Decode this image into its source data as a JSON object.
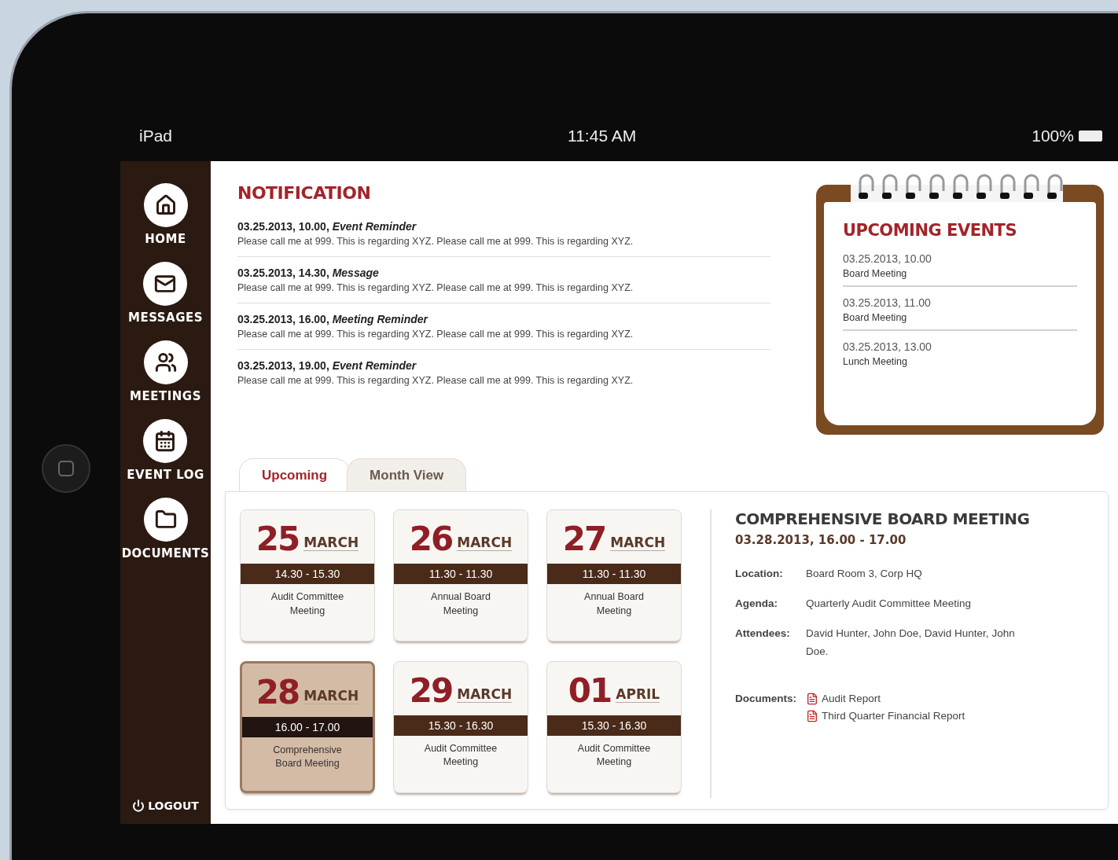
{
  "status_bar": {
    "device": "iPad",
    "time": "11:45 AM",
    "battery": "100%"
  },
  "sidebar": {
    "items": [
      {
        "label": "HOME",
        "selected": false
      },
      {
        "label": "MESSAGES",
        "selected": false
      },
      {
        "label": "MEETINGS",
        "selected": false
      },
      {
        "label": "EVENT LOG",
        "selected": false
      },
      {
        "label": "DOCUMENTS",
        "selected": false
      }
    ],
    "logout": "LOGOUT"
  },
  "notifications": {
    "title": "NOTIFICATION",
    "items": [
      {
        "heading": "03.25.2013, 10.00, *Event Reminder*",
        "message": "Please call me at 999. This is regarding XYZ. Please call me at 999. This is regarding XYZ."
      },
      {
        "heading": "03.25.2013, 14.30, *Message*",
        "message": "Please call me at 999. This is regarding XYZ. Please call me at 999. This is regarding XYZ."
      },
      {
        "heading": "03.25.2013, 16.00, *Meeting Reminder*",
        "message": "Please call me at 999. This is regarding XYZ. Please call me at 999. This is regarding XYZ."
      },
      {
        "heading": "03.25.2013, 19.00, *Event Reminder*",
        "message": "Please call me at 999. This is regarding XYZ. Please call me at 999. This is regarding XYZ."
      }
    ]
  },
  "upcoming_events": {
    "title": "UPCOMING EVENTS",
    "items": [
      {
        "datetime": "03.25.2013, 10.00",
        "name": "Board Meeting"
      },
      {
        "datetime": "03.25.2013, 11.00",
        "name": "Board Meeting"
      },
      {
        "datetime": "03.25.2013, 13.00",
        "name": "Lunch Meeting"
      }
    ]
  },
  "tabs": [
    {
      "label": "Upcoming",
      "selected": true
    },
    {
      "label": "Month View",
      "selected": false
    }
  ],
  "event_cards": [
    {
      "day": "25",
      "month": "MARCH",
      "time": "14.30 - 15.30",
      "title": "Audit Committee Meeting",
      "selected": false
    },
    {
      "day": "26",
      "month": "MARCH",
      "time": "11.30 - 11.30",
      "title": "Annual Board Meeting",
      "selected": false
    },
    {
      "day": "27",
      "month": "MARCH",
      "time": "11.30 - 11.30",
      "title": "Annual Board Meeting",
      "selected": false
    },
    {
      "day": "28",
      "month": "MARCH",
      "time": "16.00 - 17.00",
      "title": "Comprehensive Board Meeting",
      "selected": true
    },
    {
      "day": "29",
      "month": "MARCH",
      "time": "15.30 - 16.30",
      "title": "Audit Committee Meeting",
      "selected": false
    },
    {
      "day": "01",
      "month": "APRIL",
      "time": "15.30 - 16.30",
      "title": "Audit Committee Meeting",
      "selected": false
    }
  ],
  "details": {
    "title": "COMPREHENSIVE BOARD MEETING",
    "datetime": "03.28.2013, 16.00 - 17.00",
    "fields": [
      {
        "label": "Location:",
        "value": "Board Room 3, Corp HQ"
      },
      {
        "label": "Agenda:",
        "value": "Quarterly Audit Committee Meeting"
      },
      {
        "label": "Attendees:",
        "value": "David Hunter, John Doe,  David Hunter, John Doe."
      }
    ],
    "documents": {
      "label": "Documents:",
      "items": [
        "Audit Report",
        "Third Quarter Financial Report"
      ]
    }
  }
}
